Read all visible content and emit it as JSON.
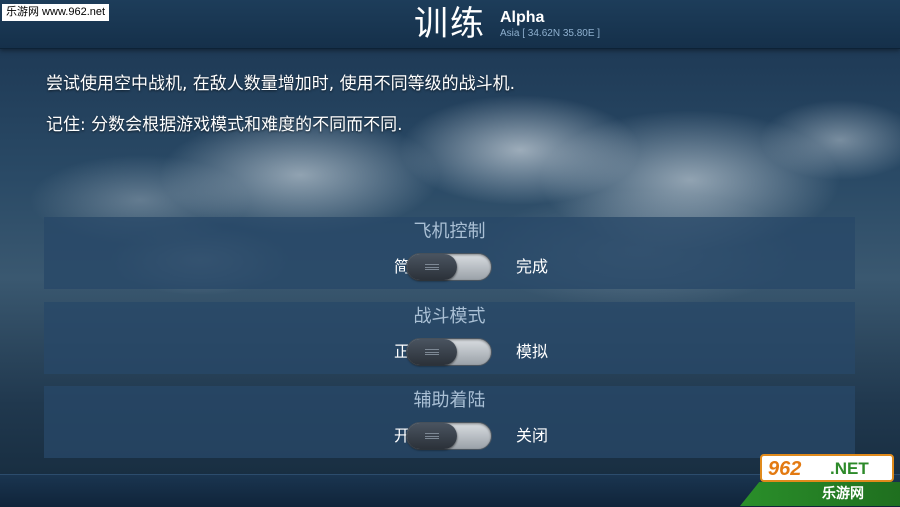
{
  "header": {
    "title": "训练",
    "mission_name": "Alpha",
    "mission_location": "Asia [ 34.62N 35.80E ]"
  },
  "watermark": {
    "top_left": "乐游网 www.962.net",
    "logo_number": "962",
    "logo_net": ".NET",
    "logo_cn": "乐游网"
  },
  "description": {
    "line1": "尝试使用空中战机, 在敌人数量增加时, 使用不同等级的战斗机.",
    "line2": "记住: 分数会根据游戏模式和难度的不同而不同."
  },
  "settings": [
    {
      "title": "飞机控制",
      "left_option": "简易",
      "right_option": "完成",
      "selected": "简易"
    },
    {
      "title": "战斗模式",
      "left_option": "正常",
      "right_option": "模拟",
      "selected": "正常"
    },
    {
      "title": "辅助着陆",
      "left_option": "开启",
      "right_option": "关闭",
      "selected": "开启"
    }
  ],
  "colors": {
    "topbar": "#1d3d5a",
    "panel": "#284868",
    "panel_title": "#a9bfd4",
    "location_text": "#8fb0cf"
  }
}
